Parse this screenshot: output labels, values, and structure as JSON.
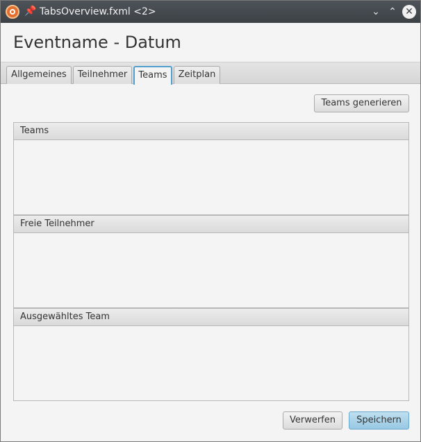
{
  "window": {
    "title": "TabsOverview.fxml <2>",
    "icons": {
      "app": "app-icon",
      "pin": "pin-icon",
      "minimize": "chevron-down-icon",
      "maximize": "chevron-up-icon",
      "close": "close-icon"
    },
    "symbols": {
      "pin": "📌",
      "minimize": "⌄",
      "maximize": "⌃",
      "close": "✕"
    }
  },
  "header": {
    "title": "Eventname - Datum"
  },
  "tabs": [
    {
      "label": "Allgemeines",
      "active": false
    },
    {
      "label": "Teilnehmer",
      "active": false
    },
    {
      "label": "Teams",
      "active": true
    },
    {
      "label": "Zeitplan",
      "active": false
    }
  ],
  "toolbar": {
    "generate_label": "Teams generieren"
  },
  "panels": {
    "teams": {
      "title": "Teams"
    },
    "free": {
      "title": "Freie Teilnehmer"
    },
    "selected": {
      "title": "Ausgewähltes Team"
    }
  },
  "footer": {
    "discard_label": "Verwerfen",
    "save_label": "Speichern"
  },
  "colors": {
    "titlebar": "#3c4146",
    "accent": "#4f9fcf",
    "primary_button": "#a9d3eb"
  }
}
